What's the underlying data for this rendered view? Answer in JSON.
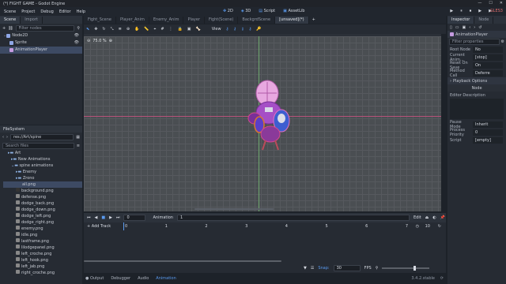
{
  "window": {
    "title": "(*) FIGHT GAME - Godot Engine",
    "controls": [
      "—",
      "☐",
      "✕"
    ]
  },
  "menu": [
    "Scene",
    "Project",
    "Debug",
    "Editor",
    "Help"
  ],
  "workspaces": [
    "2D",
    "3D",
    "Script",
    "AssetLib"
  ],
  "play_buttons": [
    "▶",
    "⏸",
    "⏹",
    "▶",
    "▶"
  ],
  "renderer_badge": "GLES3",
  "scene_dock": {
    "tabs": [
      "Scene",
      "Import"
    ],
    "filter_placeholder": "Filter nodes",
    "nodes": [
      "Node2D",
      "Sprite",
      "AnimationPlayer"
    ]
  },
  "filesystem_dock": {
    "title": "FileSystem",
    "path": "res://Art/spine animations/alf...",
    "search_placeholder": "Search files",
    "items": [
      "Art",
      "New Animations",
      "spine animations",
      "Enemy",
      "Zrono",
      "all.png",
      "background.png",
      "defense.png",
      "dodge_back.png",
      "dodge_down.png",
      "dodge_left.png",
      "dodge_right.png",
      "enemy.png",
      "idle.png",
      "lastframe.png",
      "lilodgepanel.png",
      "left_croche.png",
      "left_hook.png",
      "left_jab.png",
      "right_croche.png"
    ]
  },
  "editor_tabs": [
    "Fight_Scene",
    "Player_Anim",
    "Enemy_Anim",
    "Player",
    "Fight(Scene)",
    "BackgrdScene",
    "[unsaved](*)"
  ],
  "toolbar": {
    "view_label": "View"
  },
  "viewport": {
    "zoom_label": "75.0 %"
  },
  "animation_panel": {
    "frame_value": "0",
    "animation_label": "Animation",
    "animation_name": "1",
    "edit_label": "Edit",
    "add_track_label": "+ Add Track",
    "ticks": [
      "0",
      "1",
      "2",
      "3",
      "4",
      "5",
      "6",
      "7"
    ],
    "length_value": "10",
    "snap_label": "Snap:",
    "fps_value": "30",
    "fps_label": "FPS"
  },
  "bottom_tabs": [
    "Output",
    "Debugger",
    "Audio",
    "Animation"
  ],
  "version": "3.4.2.stable",
  "inspector": {
    "tabs": [
      "Inspector",
      "Node"
    ],
    "node_name": "AnimationPlayer",
    "filter_placeholder": "Filter properties",
    "props": [
      {
        "k": "Root Node",
        "v": "No"
      },
      {
        "k": "Current Anim...",
        "v": "[stop]"
      },
      {
        "k": "Reset On Save",
        "v": "On"
      },
      {
        "k": "Method Call",
        "v": "Deferre"
      }
    ],
    "section": "Playback Options",
    "section_value": "Node",
    "desc_label": "Editor Description",
    "props2": [
      {
        "k": "Pause Mode",
        "v": "Inherit"
      },
      {
        "k": "Process Priority",
        "v": "0"
      },
      {
        "k": "Script",
        "v": "[empty]"
      }
    ]
  }
}
